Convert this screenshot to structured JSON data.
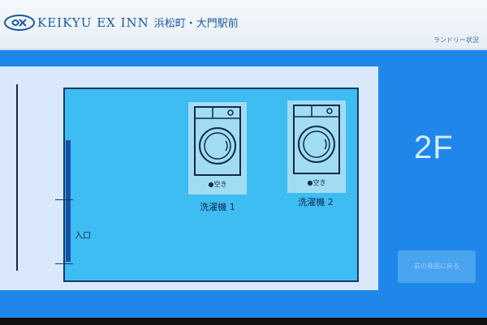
{
  "header": {
    "brand": "KEIKYU EX INN",
    "location": "浜松町・大門駅前",
    "page_label": "ランドリー状況"
  },
  "map": {
    "entrance_label": "入口",
    "washers": [
      {
        "name": "洗濯機 1",
        "status": "●空き"
      },
      {
        "name": "洗濯機 2",
        "status": "●空き"
      }
    ]
  },
  "floor": "2F",
  "back_button": "前の画面に戻る",
  "colors": {
    "screen_bg": "#1f87ea",
    "room": "#3ebdf2",
    "washer_tile": "#a2dcf4",
    "brand": "#1a5b9e"
  }
}
